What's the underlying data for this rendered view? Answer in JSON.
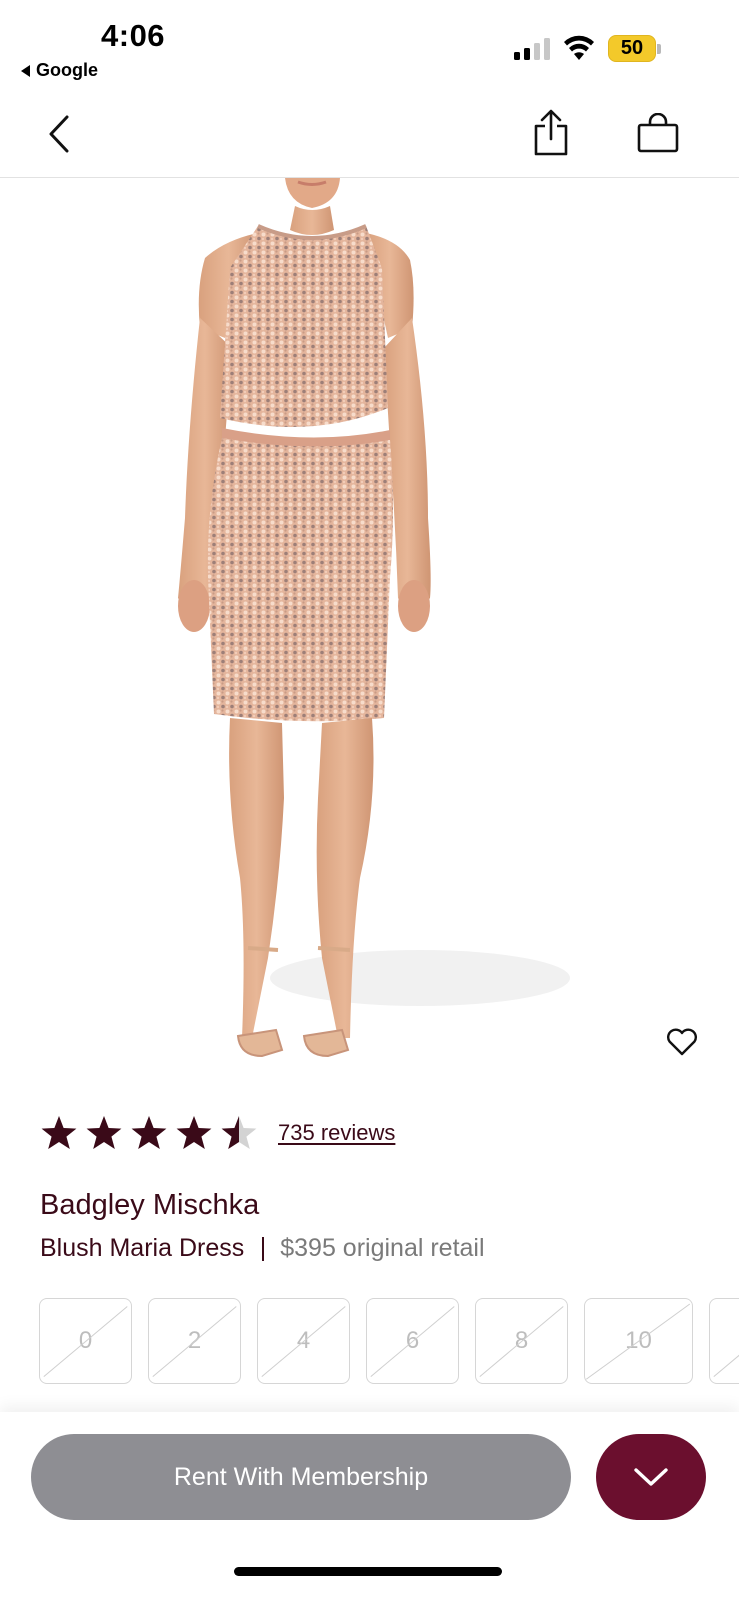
{
  "status_bar": {
    "time": "4:06",
    "back_app_label": "Google",
    "battery_level": "50",
    "battery_color": "#f3c92a"
  },
  "nav": {
    "back_icon": "chevron-left-icon",
    "share_icon": "share-icon",
    "bag_icon": "shopping-bag-icon"
  },
  "product": {
    "image_icon": "product-photo",
    "favorite_icon": "heart-icon",
    "rating": 4.5,
    "rating_max": 5,
    "reviews_label": "735 reviews",
    "brand": "Badgley Mischka",
    "name": "Blush Maria Dress",
    "retail_price": "$395 original retail"
  },
  "sizes": {
    "options": [
      "0",
      "2",
      "4",
      "6",
      "8",
      "10"
    ],
    "all_unavailable": true
  },
  "actions": {
    "rent_label": "Rent With Membership",
    "rent_color": "#8e8e93",
    "expand_icon": "chevron-down-icon",
    "accent_color": "#6b0f2e"
  },
  "text_color": "#3a0a18"
}
